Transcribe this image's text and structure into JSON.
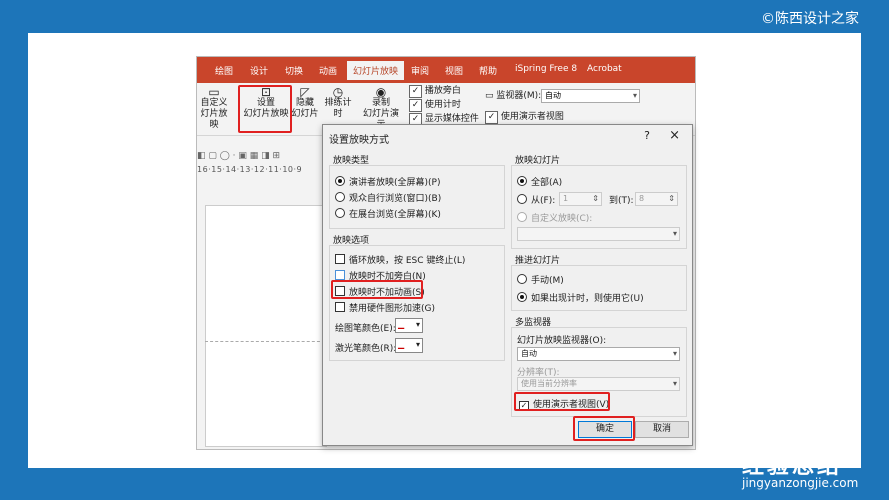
{
  "watermark_top": "©陈西设计之家",
  "watermark_bottom": {
    "brand": "经验总结",
    "url": "jingyanzongjie.com"
  },
  "ribbon": {
    "tabs": [
      "绘图",
      "设计",
      "切换",
      "动画",
      "幻灯片放映",
      "审阅",
      "视图",
      "帮助",
      "iSpring Free 8",
      "Acrobat"
    ],
    "active_tab": "幻灯片放映",
    "custom_show": [
      "自定义",
      "灯片放映"
    ],
    "setup_show": [
      "设置",
      "幻灯片放映"
    ],
    "hide_slide": [
      "隐藏",
      "幻灯片"
    ],
    "rehearse": "排练计时",
    "record": [
      "录制",
      "幻灯片演示"
    ],
    "checks": [
      "播放旁白",
      "使用计时",
      "显示媒体控件"
    ],
    "monitor_label": "监视器(M):",
    "monitor_value": "自动",
    "presenter_view": "使用演示者视图"
  },
  "ruler_text": "16·15·14·13·12·11·10·9",
  "dialog": {
    "title": "设置放映方式",
    "help": "?",
    "close": "×",
    "show_type": {
      "title": "放映类型",
      "options": [
        "演讲者放映(全屏幕)(P)",
        "观众自行浏览(窗口)(B)",
        "在展台浏览(全屏幕)(K)"
      ]
    },
    "show_options": {
      "title": "放映选项",
      "items": [
        "循环放映，按 ESC 键终止(L)",
        "放映时不加旁白(N)",
        "放映时不加动画(S)",
        "禁用硬件图形加速(G)"
      ],
      "pen_color_label": "绘图笔颜色(E):",
      "laser_color_label": "激光笔颜色(R):"
    },
    "show_slides": {
      "title": "放映幻灯片",
      "all": "全部(A)",
      "from": "从(F):",
      "from_value": "1",
      "to": "到(T):",
      "to_value": "8",
      "custom": "自定义放映(C):"
    },
    "advance": {
      "title": "推进幻灯片",
      "manual": "手动(M)",
      "timings": "如果出现计时，则使用它(U)"
    },
    "multi_monitor": {
      "title": "多监视器",
      "monitor_label": "幻灯片放映监视器(O):",
      "monitor_value": "自动",
      "resolution_label": "分辨率(T):",
      "resolution_value": "使用当前分辨率",
      "presenter_view": "使用演示者视图(V)"
    },
    "ok": "确定",
    "cancel": "取消"
  }
}
